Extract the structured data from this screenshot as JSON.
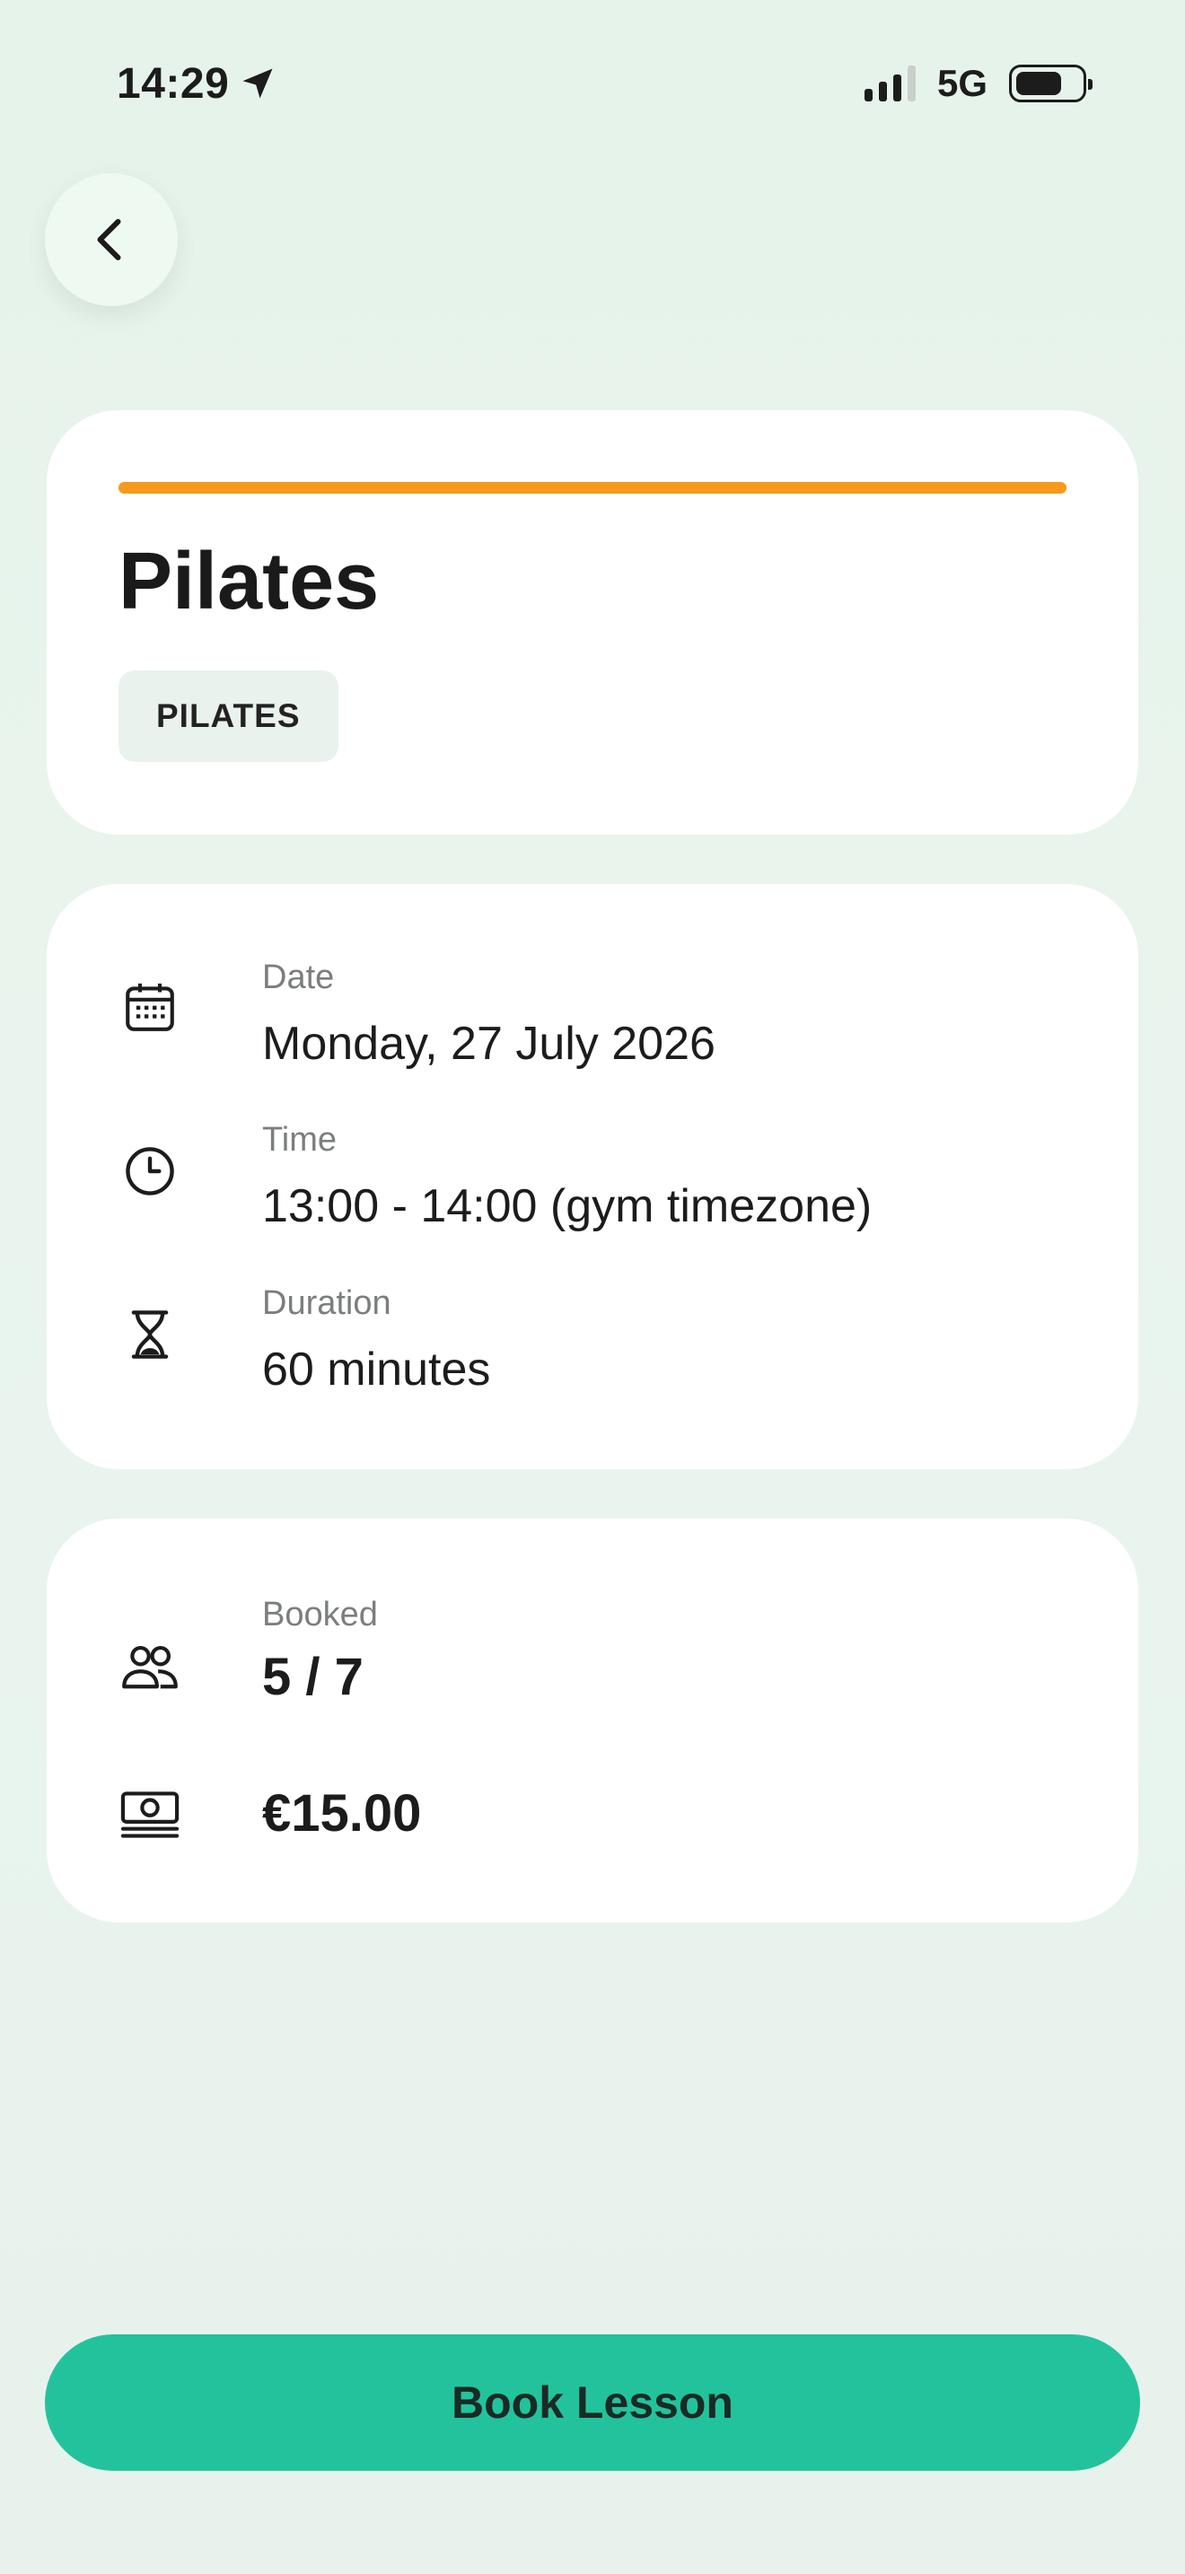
{
  "status_bar": {
    "time": "14:29",
    "network": "5G"
  },
  "class": {
    "title": "Pilates",
    "category": "PILATES",
    "accent_color": "#f7991c"
  },
  "details": {
    "date_label": "Date",
    "date_value": "Monday, 27 July 2026",
    "time_label": "Time",
    "time_value": "13:00 - 14:00 (gym timezone)",
    "duration_label": "Duration",
    "duration_value": "60 minutes"
  },
  "booking": {
    "booked_label": "Booked",
    "booked_value": "5 / 7",
    "price": "€15.00"
  },
  "actions": {
    "book_label": "Book Lesson",
    "book_color": "#22c39c"
  },
  "icons": {
    "back": "chevron-left-icon",
    "location": "location-arrow-icon",
    "date": "calendar-icon",
    "time": "clock-icon",
    "duration": "hourglass-icon",
    "booked": "people-icon",
    "price": "cash-icon"
  }
}
